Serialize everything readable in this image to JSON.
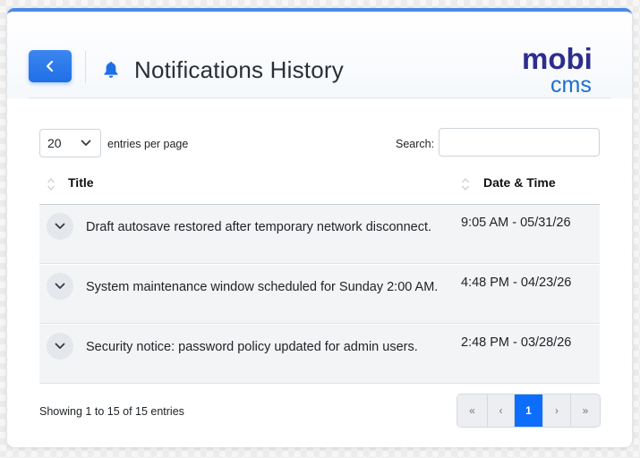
{
  "header": {
    "back_label": "‹",
    "title": "Notifications History",
    "logo_top": "mobi",
    "logo_bottom": "cms",
    "brand_dark": "#2d2d8f",
    "brand_blue": "#1a6fd0",
    "accent": "#1f6fe6"
  },
  "controls": {
    "page_length": "20",
    "length_label": "entries per page",
    "search_label": "Search:",
    "search_value": ""
  },
  "table": {
    "columns": [
      "Title",
      "Date & Time"
    ],
    "rows": [
      {
        "title": "Draft autosave restored after temporary network disconnect.",
        "datetime": "9:05 AM - 05/31/26"
      },
      {
        "title": "System maintenance window scheduled for Sunday 2:00 AM.",
        "datetime": "4:48 PM - 04/23/26"
      },
      {
        "title": "Security notice: password policy updated for admin users.",
        "datetime": "2:48 PM - 03/28/26"
      }
    ]
  },
  "footer": {
    "info": "Showing 1 to 15 of 15 entries",
    "pagination": {
      "first": "«",
      "prev": "‹",
      "current": "1",
      "next": "›",
      "last": "»"
    }
  }
}
